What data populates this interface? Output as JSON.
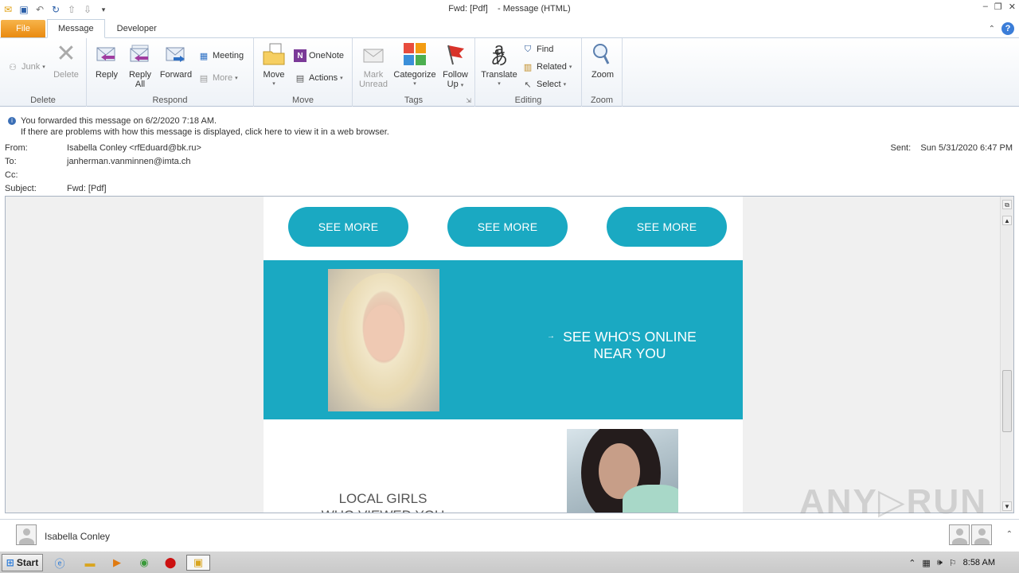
{
  "window": {
    "title": "Fwd: [Pdf]",
    "title_suffix": "- Message (HTML)"
  },
  "tabs": [
    {
      "label": "File"
    },
    {
      "label": "Message"
    },
    {
      "label": "Developer"
    }
  ],
  "ribbon": {
    "delete_group": {
      "label": "Delete",
      "junk": "Junk",
      "delete": "Delete"
    },
    "respond_group": {
      "label": "Respond",
      "reply": "Reply",
      "reply_all_1": "Reply",
      "reply_all_2": "All",
      "forward": "Forward",
      "meeting": "Meeting",
      "more": "More"
    },
    "move_group": {
      "label": "Move",
      "move": "Move",
      "onenote": "OneNote",
      "actions": "Actions"
    },
    "tags_group": {
      "label": "Tags",
      "mark_unread_1": "Mark",
      "mark_unread_2": "Unread",
      "categorize": "Categorize",
      "follow_up_1": "Follow",
      "follow_up_2": "Up"
    },
    "editing_group": {
      "label": "Editing",
      "translate": "Translate",
      "find": "Find",
      "related": "Related",
      "select": "Select"
    },
    "zoom_group": {
      "label": "Zoom",
      "zoom": "Zoom"
    }
  },
  "header": {
    "info_forwarded": "You forwarded this message on 6/2/2020 7:18 AM.",
    "info_problems": "If there are problems with how this message is displayed, click here to view it in a web browser.",
    "from_label": "From:",
    "from_value": "Isabella Conley <rfEduard@bk.ru>",
    "to_label": "To:",
    "to_value": "janherman.vanminnen@imta.ch",
    "cc_label": "Cc:",
    "cc_value": "",
    "subject_label": "Subject:",
    "subject_value": "Fwd: [Pdf]",
    "sent_label": "Sent:",
    "sent_value": "Sun 5/31/2020 6:47 PM"
  },
  "message_body": {
    "see_more_1": "SEE MORE",
    "see_more_2": "SEE MORE",
    "see_more_3": "SEE MORE",
    "online_arrow": "→",
    "online_line1": "SEE WHO'S ONLINE",
    "online_line2": "NEAR YOU",
    "local_line1": "LOCAL GIRLS",
    "local_line2": "WHO VIEWED YOU",
    "accent_color": "#1aa9c2"
  },
  "watermark": "ANY▷RUN",
  "people_pane": {
    "name": "Isabella Conley"
  },
  "taskbar": {
    "start": "Start",
    "clock": "8:58 AM"
  }
}
